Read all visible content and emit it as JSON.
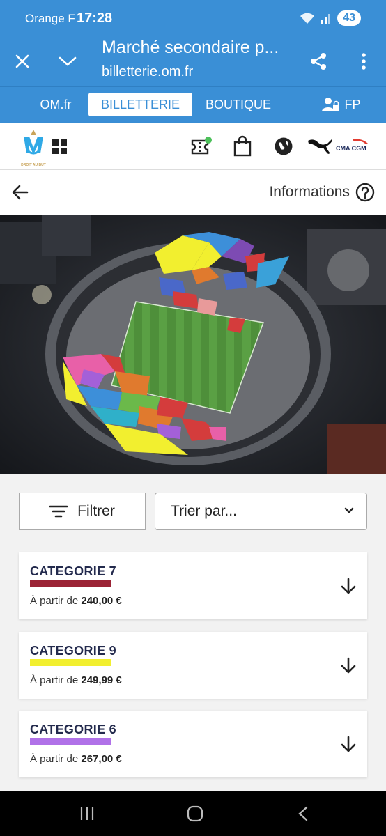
{
  "status": {
    "carrier": "Orange F",
    "time": "17:28",
    "battery": "43"
  },
  "browser": {
    "title": "Marché secondaire p...",
    "url": "billetterie.om.fr"
  },
  "site_tabs": [
    {
      "label": "OM.fr"
    },
    {
      "label": "BILLETTERIE"
    },
    {
      "label": "BOUTIQUE"
    },
    {
      "label": "FP"
    }
  ],
  "header": {
    "logo_tagline": "DROIT AU BUT",
    "sponsor": "CMA CGM"
  },
  "info": {
    "label": "Informations"
  },
  "filters": {
    "filter_label": "Filtrer",
    "sort_placeholder": "Trier par..."
  },
  "categories": [
    {
      "name": "CATEGORIE 7",
      "price_prefix": "À partir de",
      "price": "240,00 €",
      "color": "#9b2335"
    },
    {
      "name": "CATEGORIE 9",
      "price_prefix": "À partir de",
      "price": "249,99 €",
      "color": "#f2ef2f"
    },
    {
      "name": "CATEGORIE 6",
      "price_prefix": "À partir de",
      "price": "267,00 €",
      "color": "#b071e8"
    }
  ],
  "colors": {
    "brand_blue": "#3a8fd6",
    "navy": "#232a4d"
  }
}
